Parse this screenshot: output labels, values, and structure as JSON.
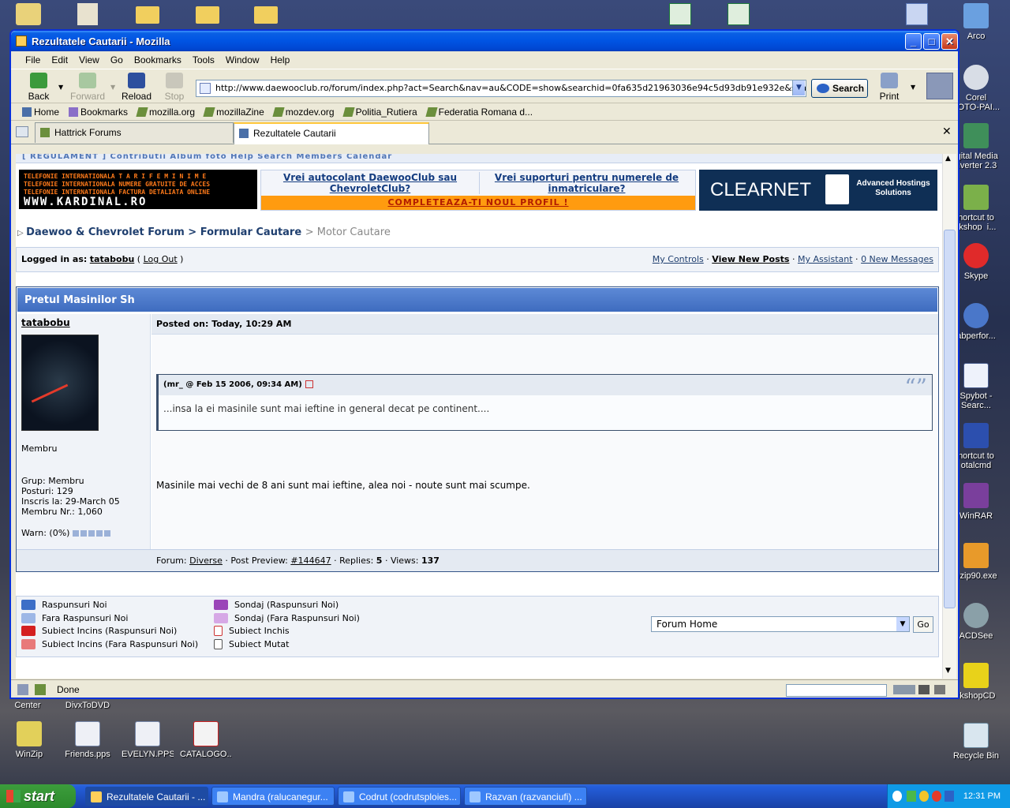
{
  "desktop": {
    "top_icons": [],
    "right_icons": [
      "Arco",
      "Corel\nFOTO-PAI...",
      "igital Media\nnverter 2.3",
      "hortcut to\nrkshop_i...",
      "Skype",
      "abperfor...",
      "Spybot -\nSearc...",
      "hortcut to\notalcmd",
      "WinRAR",
      "nzip90.exe",
      "ACDSee",
      "rkshopCD",
      "Recycle Bin"
    ],
    "bottom_icons": [
      "WinZip",
      "Friends.pps",
      "EVELYN.PPS",
      "CATALOGO...."
    ],
    "partial_labels": [
      "Center",
      "DivxToDVD"
    ]
  },
  "window": {
    "title": "Rezultatele Cautarii - Mozilla",
    "menu": [
      "File",
      "Edit",
      "View",
      "Go",
      "Bookmarks",
      "Tools",
      "Window",
      "Help"
    ],
    "nav": {
      "back": "Back",
      "forward": "Forward",
      "reload": "Reload",
      "stop": "Stop",
      "print": "Print"
    },
    "url": "http://www.daewooclub.ro/forum/index.php?act=Search&nav=au&CODE=show&searchid=0fa635d21963036e94c5d93db91e932e&search_in=posts8",
    "search_label": "Search",
    "bookmarks": [
      "Home",
      "Bookmarks",
      "mozilla.org",
      "mozillaZine",
      "mozdev.org",
      "Politia_Rutiera",
      "Federatia Romana d..."
    ],
    "tabs": [
      {
        "label": "Hattrick Forums"
      },
      {
        "label": "Rezultatele Cautarii"
      }
    ],
    "status": "Done"
  },
  "page": {
    "topstrip": "[ REGULAMENT ]  Contributii  Album foto                                                                                                   Help  Search  Members  Calendar",
    "banner_left": {
      "lines": [
        "TELEFONIE INTERNATIONALA   T A R I F E   M I N I M E",
        "TELEFONIE INTERNATIONALA   NUMERE GRATUITE DE ACCES",
        "TELEFONIE INTERNATIONALA   FACTURA DETALIATA ONLINE"
      ],
      "site": "WWW.KARDINAL.RO"
    },
    "promo": {
      "link1": "Vrei autocolant DaewooClub sau ChevroletClub?",
      "link2": "Vrei suporturi pentru numerele de inmatriculare?",
      "cta": "COMPLETEAZA-TI NOUL PROFIL !"
    },
    "banner_right": {
      "brand": "CLEARNET",
      "slogan": "Advanced Hostings Solutions"
    },
    "breadcrumb": {
      "a": "Daewoo & Chevrolet Forum",
      "b": "Formular Cautare",
      "c": "Motor Cautare"
    },
    "login": {
      "prefix": "Logged in as:",
      "user": "tatabobu",
      "logout": "Log Out"
    },
    "controls": [
      "My Controls",
      "View New Posts",
      "My Assistant",
      "0 New Messages"
    ],
    "post": {
      "title": "Pretul Masinilor Sh",
      "author": "tatabobu",
      "role": "Membru",
      "group": "Grup: Membru",
      "posts": "Posturi: 129",
      "joined": "Inscris la: 29-March 05",
      "member_no": "Membru Nr.: 1,060",
      "warn": "Warn: (0%)",
      "posted": "Posted on: Today, 10:29 AM",
      "quote_header": "(mr_ @ Feb 15 2006, 09:34 AM)",
      "quote_text": "...insa la ei masinile sunt mai ieftine in general decat pe continent....",
      "body": "Masinile mai vechi de 8 ani sunt mai ieftine, alea noi - noute sunt mai scumpe.",
      "footer": {
        "forum_label": "Forum:",
        "forum": "Diverse",
        "preview_label": "Post Preview:",
        "preview": "#144647",
        "replies_label": "Replies:",
        "replies": "5",
        "views_label": "Views:",
        "views": "137"
      }
    },
    "legend": [
      "Raspunsuri Noi",
      "Fara Raspunsuri Noi",
      "Subiect Incins (Raspunsuri Noi)",
      "Subiect Incins (Fara Raspunsuri Noi)",
      "Sondaj (Raspunsuri Noi)",
      "Sondaj (Fara Raspunsuri Noi)",
      "Subiect Inchis",
      "Subiect Mutat"
    ],
    "jump": {
      "value": "Forum Home",
      "go": "Go"
    }
  },
  "taskbar": {
    "start": "start",
    "tasks": [
      "Rezultatele Cautarii - ...",
      "Mandra (ralucanegur...",
      "Codrut (codrutsploies...",
      "Razvan (razvanciufi) ..."
    ],
    "clock": "12:31 PM"
  }
}
